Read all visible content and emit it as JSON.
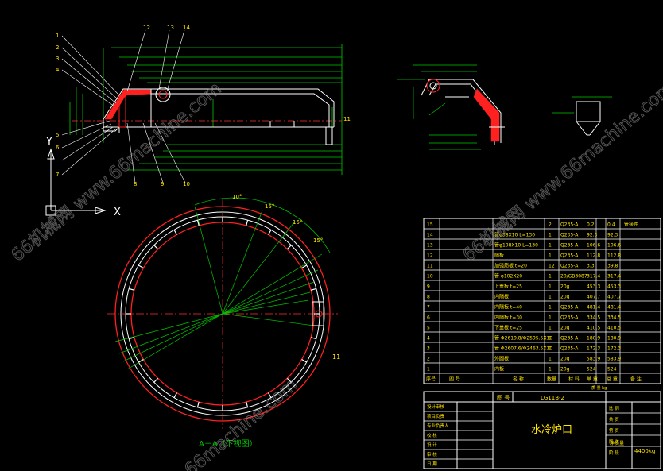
{
  "title_block": {
    "drawing_no": "LG11B-2",
    "name": "水冷炉口",
    "weight": "4400kg",
    "scale_label": "图 号",
    "weight_label": "净质量",
    "left_cells": [
      "设计审核",
      "项目负责",
      "专业负责人",
      "校 核",
      "设 计",
      "审 核",
      "日 期"
    ],
    "right_cells": [
      "比 例",
      "共 页",
      "第 页",
      "版 次",
      "阶 段"
    ]
  },
  "parts_header": {
    "no": "序号",
    "code": "图 号",
    "name": "名 称",
    "qty": "数量",
    "material": "材 料",
    "unit": "单 重",
    "total": "总 重",
    "remark": "备 注",
    "sub": "质 量 kg"
  },
  "parts": [
    {
      "no": "15",
      "name": "",
      "qty": "2",
      "mat": "Q235-A",
      "unit": "0.2",
      "total": "0.4",
      "remark": "管接件"
    },
    {
      "no": "14",
      "name": "管φ38X10 L=130",
      "qty": "1",
      "mat": "Q235-A",
      "unit": "92.3",
      "total": "92.3",
      "remark": ""
    },
    {
      "no": "13",
      "name": "管φ108X10 L=130",
      "qty": "1",
      "mat": "Q235-A",
      "unit": "106.6",
      "total": "106.6",
      "remark": ""
    },
    {
      "no": "12",
      "name": "隔板",
      "qty": "1",
      "mat": "Q235-A",
      "unit": "112.8",
      "total": "112.8",
      "remark": ""
    },
    {
      "no": "11",
      "name": "加强筋板 t=20",
      "qty": "12",
      "mat": "Q235-A",
      "unit": "3.3",
      "total": "39.8",
      "remark": ""
    },
    {
      "no": "10",
      "name": "管 φ102X20",
      "qty": "1",
      "mat": "20/GB3087",
      "unit": "317.4",
      "total": "317.4",
      "remark": ""
    },
    {
      "no": "9",
      "name": "上盖板 t=25",
      "qty": "1",
      "mat": "20g",
      "unit": "453.3",
      "total": "453.3",
      "remark": ""
    },
    {
      "no": "8",
      "name": "内隔板",
      "qty": "1",
      "mat": "20g",
      "unit": "407.7",
      "total": "407.7",
      "remark": ""
    },
    {
      "no": "7",
      "name": "内隔板 t=40",
      "qty": "1",
      "mat": "Q235-A",
      "unit": "481.4",
      "total": "481.4",
      "remark": ""
    },
    {
      "no": "6",
      "name": "内隔板 t=30",
      "qty": "1",
      "mat": "Q235-A",
      "unit": "334.5",
      "total": "334.5",
      "remark": ""
    },
    {
      "no": "5",
      "name": "下盖板 t=25",
      "qty": "1",
      "mat": "20g",
      "unit": "410.5",
      "total": "410.5",
      "remark": ""
    },
    {
      "no": "4",
      "name": "管 Φ2619.8/Φ2595.5X10",
      "qty": "1",
      "mat": "Q235-A",
      "unit": "180.9",
      "total": "180.9",
      "remark": ""
    },
    {
      "no": "3",
      "name": "管 Φ2607.6/Φ2463.5X10",
      "qty": "1",
      "mat": "Q235-A",
      "unit": "172.3",
      "total": "172.3",
      "remark": ""
    },
    {
      "no": "2",
      "name": "外圆板",
      "qty": "1",
      "mat": "20g",
      "unit": "583.9",
      "total": "583.9",
      "remark": ""
    },
    {
      "no": "1",
      "name": "内板",
      "qty": "1",
      "mat": "20g",
      "unit": "524",
      "total": "524",
      "remark": ""
    }
  ],
  "section_label": "A－A（下视图）",
  "axis": {
    "y": "Y",
    "x": "X"
  },
  "leaders_top": [
    "1",
    "2",
    "3",
    "4",
    "5",
    "6",
    "7",
    "8",
    "9",
    "10",
    "12",
    "13",
    "14",
    "11"
  ],
  "angle_labels": [
    "10°",
    "15°",
    "15°",
    "15°"
  ],
  "watermarks": [
    "66机械网 www.66machine.com",
    "66机械网 www.66machine.com",
    "66machine.com"
  ],
  "colors": {
    "cad_line": "#ffffff",
    "dim": "#00c800",
    "center": "#ff3030",
    "section": "#ff3030",
    "text": "#ffe600",
    "frame": "#ffffff"
  }
}
